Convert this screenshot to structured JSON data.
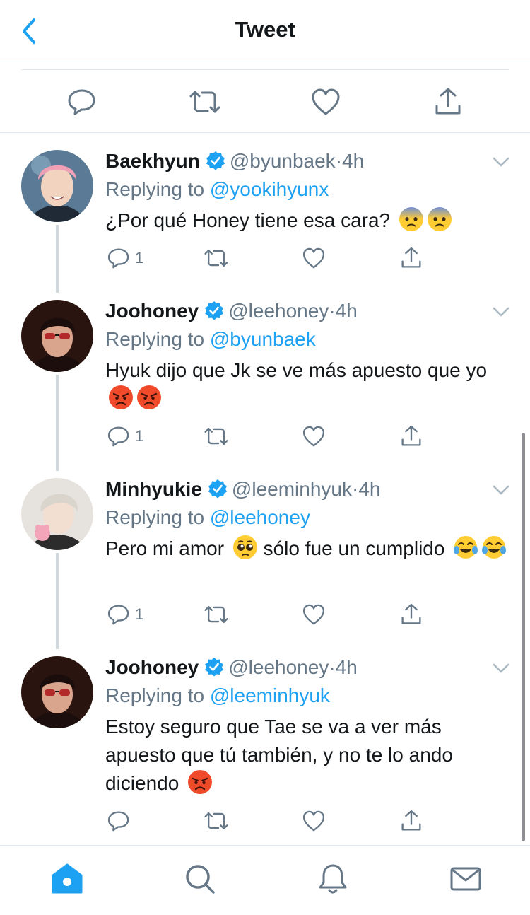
{
  "header": {
    "title": "Tweet"
  },
  "colors": {
    "accent": "#1da1f2",
    "text": "#14171a",
    "secondary": "#657786",
    "border": "#e1e8ed"
  },
  "main_tweet_actions": [
    "reply-icon",
    "retweet-icon",
    "like-icon",
    "share-icon"
  ],
  "tweets": [
    {
      "name": "Baekhyun",
      "handle": "@byunbaek",
      "dot": "·",
      "time": "4h",
      "replying_label": "Replying to",
      "replying_to": "@yookihyunx",
      "text": "¿Por qué Honey tiene esa cara?",
      "emojis": [
        "anxious-face",
        "anxious-face"
      ],
      "reply_count": "1"
    },
    {
      "name": "Joohoney",
      "handle": "@leehoney",
      "dot": "·",
      "time": "4h",
      "replying_label": "Replying to",
      "replying_to": "@byunbaek",
      "text": "Hyuk dijo que Jk se ve más apuesto que yo",
      "emojis": [
        "angry-face",
        "angry-face"
      ],
      "reply_count": "1"
    },
    {
      "name": "Minhyukie",
      "handle": "@leeminhyuk",
      "dot": "·",
      "time": "4h",
      "replying_label": "Replying to",
      "replying_to": "@leehoney",
      "text_before": "Pero mi amor",
      "text_after": "sólo fue un cumplido",
      "emojis": [
        "pleading-face",
        "tears-of-joy-face",
        "tears-of-joy-face"
      ],
      "reply_count": "1"
    },
    {
      "name": "Joohoney",
      "handle": "@leehoney",
      "dot": "·",
      "time": "4h",
      "replying_label": "Replying to",
      "replying_to": "@leeminhyuk",
      "text": "Estoy seguro que Tae se va a ver más apuesto que tú también, y no te lo ando diciendo",
      "emojis": [
        "angry-face"
      ],
      "reply_count": ""
    }
  ],
  "tabbar": {
    "items": [
      "home-icon",
      "search-icon",
      "notifications-icon",
      "messages-icon"
    ],
    "active": "home-icon"
  }
}
